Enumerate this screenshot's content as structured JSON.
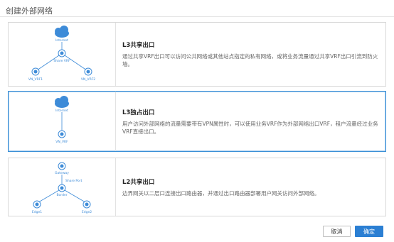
{
  "dialog": {
    "title": "创建外部网络"
  },
  "cards": [
    {
      "heading": "L3共享出口",
      "description": "通过共享VRF出口可以访问公共网络或其他站点指定的私有网络，或将业务流量通过共享VRF出口引流到防火墙。",
      "diagram_labels": [
        "Internet",
        "Share VRF",
        "VN_VRF1",
        "VN_VRF2"
      ]
    },
    {
      "heading": "L3独占出口",
      "description": "用户访问外部网络的流量需要带有VPN属性时，可以使用业务VRF作为外部网络出口VRF，租户流量经过业务VRF直接出口。",
      "diagram_labels": [
        "Internet",
        "VN_VRF"
      ]
    },
    {
      "heading": "L2共享出口",
      "description": "边界网关以二层口连接出口路由器，并通过出口路由器部署用户网关访问外部网络。",
      "diagram_labels": [
        "Gateway",
        "Share Port",
        "Border",
        "Edge1",
        "Edge2"
      ]
    }
  ],
  "buttons": {
    "cancel": "取消",
    "confirm": "确定"
  },
  "colors": {
    "accent": "#2b7fd3",
    "cloud": "#3d8bd8",
    "selected_border": "#3a8fd6"
  }
}
